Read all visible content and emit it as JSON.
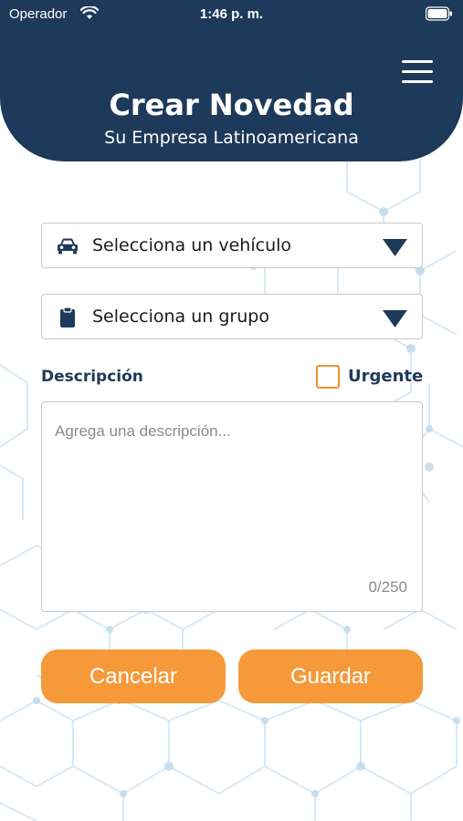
{
  "status_bar": {
    "carrier": "Operador",
    "time": "1:46 p. m."
  },
  "header": {
    "title": "Crear Novedad",
    "subtitle": "Su Empresa Latinoamericana",
    "menu_icon": "hamburger-menu-icon"
  },
  "form": {
    "vehicle_select": {
      "label": "Selecciona un vehículo",
      "icon": "car-icon"
    },
    "group_select": {
      "label": "Selecciona un grupo",
      "icon": "clipboard-icon"
    },
    "description_label": "Descripción",
    "urgent_label": "Urgente",
    "urgent_checked": false,
    "description_placeholder": "Agrega una descripción...",
    "description_value": "",
    "char_counter": "0/250"
  },
  "actions": {
    "cancel_label": "Cancelar",
    "save_label": "Guardar"
  },
  "colors": {
    "header_bg": "#1e3a5a",
    "accent_orange": "#f5993a",
    "label_navy": "#1e3a5a"
  }
}
